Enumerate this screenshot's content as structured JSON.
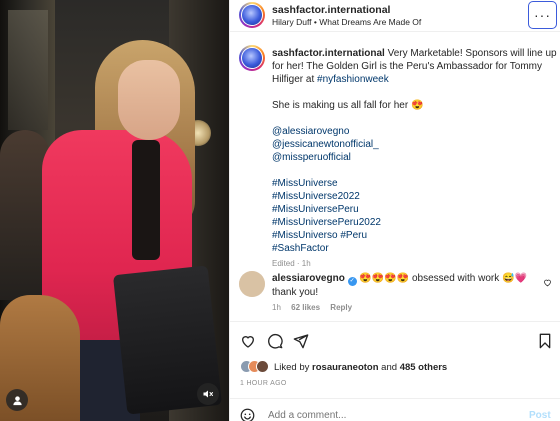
{
  "header": {
    "username": "sashfactor.international",
    "audio": "Hilary Duff • What Dreams Are Made Of",
    "more_label": "···"
  },
  "caption": {
    "username": "sashfactor.international",
    "text_1": " Very Marketable! Sponsors will line up for her! The Golden Girl is the Peru's Ambassador for Tommy Hilfiger at ",
    "hashtag_event": "#nyfashionweek",
    "line_2": "She is making us all fall for her 😍",
    "mentions": [
      "@alessiarovegno",
      "@jessicanewtonofficial_",
      "@missperuofficial"
    ],
    "hashtags": [
      "#MissUniverse",
      "#MissUniverse2022",
      "#MissUniversePeru",
      "#MissUniversePeru2022"
    ],
    "hashtag_mixed_a": "#MissUniverso",
    "hashtag_mixed_b": "#Peru",
    "hashtag_last": "#SashFactor",
    "meta": "Edited · 1h"
  },
  "comment": {
    "username": "alessiarovegno",
    "verified_mark": "✓",
    "text": " 😍😍😍😍 obsessed with work 😅💗 thank you!",
    "time": "1h",
    "likes": "62 likes",
    "reply": "Reply"
  },
  "likes": {
    "prefix": "Liked by ",
    "user": "rosauraneoton",
    "middle": " and ",
    "others": "485 others"
  },
  "posted": "1 HOUR AGO",
  "add_comment": {
    "placeholder": "Add a comment...",
    "post_label": "Post"
  },
  "colors": {
    "link": "#00376b",
    "accent": "#3b5bdb",
    "post_disabled": "#b2dffc",
    "jacket": "#e02650"
  },
  "icons": [
    "user-icon",
    "mute-icon",
    "more-icon",
    "heart-icon",
    "comment-icon",
    "share-icon",
    "bookmark-icon",
    "emoji-icon"
  ]
}
